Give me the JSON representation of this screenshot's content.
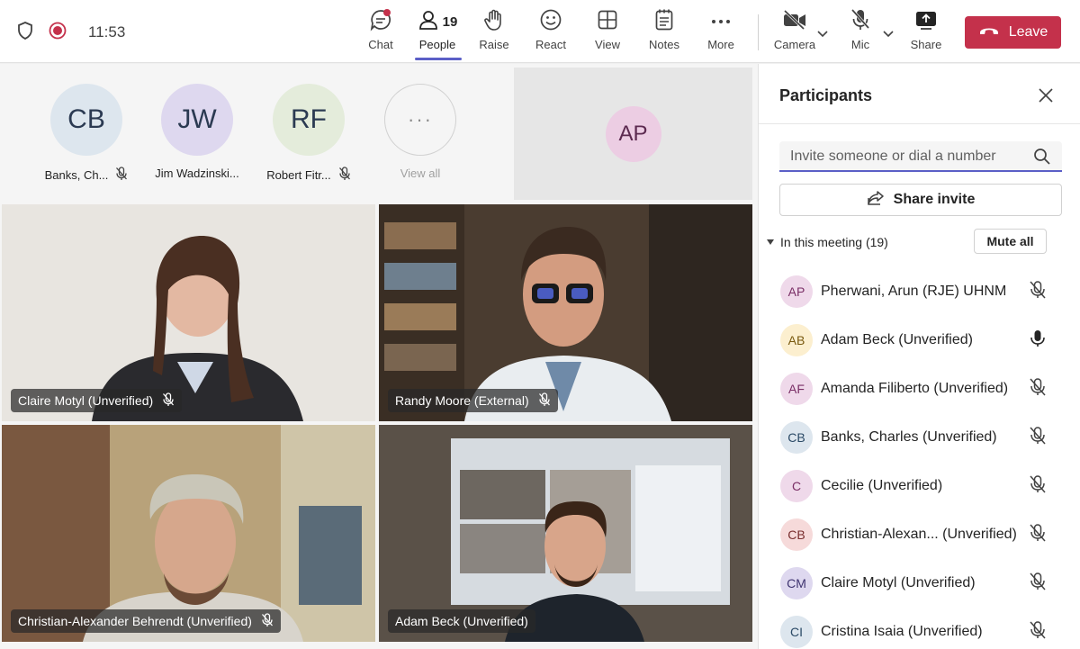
{
  "topbar": {
    "time": "11:53",
    "buttons": {
      "chat": "Chat",
      "people": "People",
      "people_count": "19",
      "raise": "Raise",
      "react": "React",
      "view": "View",
      "notes": "Notes",
      "more": "More",
      "camera": "Camera",
      "mic": "Mic",
      "share": "Share"
    },
    "leave": "Leave",
    "colors": {
      "accent": "#5b5fc7",
      "leave": "#c4314b"
    }
  },
  "avatar_strip": [
    {
      "initials": "CB",
      "name": "Banks, Ch...",
      "muted": true,
      "color": "#dde6ee"
    },
    {
      "initials": "JW",
      "name": "Jim Wadzinski...",
      "muted": false,
      "color": "#ded8ef"
    },
    {
      "initials": "RF",
      "name": "Robert Fitr...",
      "muted": true,
      "color": "#e4ecdb"
    }
  ],
  "view_all": "View all",
  "spotlight": {
    "initials": "AP"
  },
  "video_tiles": [
    {
      "name": "Claire Motyl (Unverified)"
    },
    {
      "name": "Randy Moore (External)"
    },
    {
      "name": "Christian-Alexander Behrendt (Unverified)"
    },
    {
      "name": "Adam Beck (Unverified)"
    }
  ],
  "panel": {
    "title": "Participants",
    "search_placeholder": "Invite someone or dial a number",
    "share_invite": "Share invite",
    "in_meeting": "In this meeting (19)",
    "mute_all": "Mute all",
    "participants": [
      {
        "initials": "AP",
        "name": "Pherwani, Arun (RJE) UHNM",
        "mic": "muted",
        "bg": "#efd9ea",
        "fg": "#7a2f66"
      },
      {
        "initials": "AB",
        "name": "Adam Beck (Unverified)",
        "mic": "on",
        "bg": "#fcefcf",
        "fg": "#7a5a10"
      },
      {
        "initials": "AF",
        "name": "Amanda Filiberto (Unverified)",
        "mic": "muted",
        "bg": "#efd9ea",
        "fg": "#7a2f66"
      },
      {
        "initials": "CB",
        "name": "Banks, Charles (Unverified)",
        "mic": "muted",
        "bg": "#dde6ee",
        "fg": "#2b4a66"
      },
      {
        "initials": "C",
        "name": "Cecilie (Unverified)",
        "mic": "muted",
        "bg": "#efd9ea",
        "fg": "#7a2f66"
      },
      {
        "initials": "CB",
        "name": "Christian-Alexan... (Unverified)",
        "mic": "muted",
        "bg": "#f6dada",
        "fg": "#7a2f2f"
      },
      {
        "initials": "CM",
        "name": "Claire Motyl (Unverified)",
        "mic": "muted",
        "bg": "#ded8ef",
        "fg": "#3f3470"
      },
      {
        "initials": "CI",
        "name": "Cristina Isaia (Unverified)",
        "mic": "muted",
        "bg": "#dde6ee",
        "fg": "#2b4a66"
      }
    ]
  }
}
